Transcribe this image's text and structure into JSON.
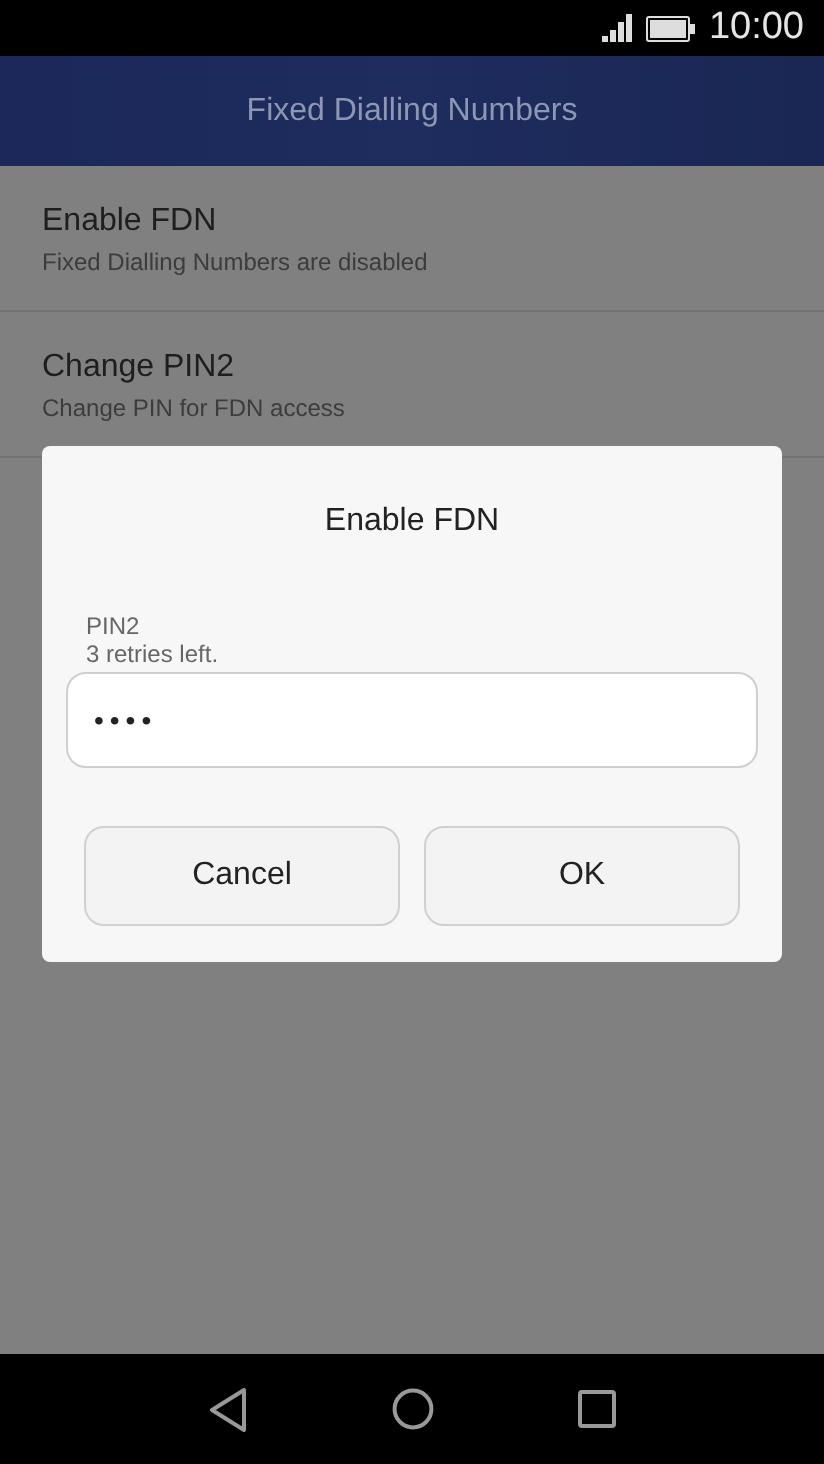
{
  "status_bar": {
    "time": "10:00"
  },
  "header": {
    "title": "Fixed Dialling Numbers"
  },
  "settings": [
    {
      "title": "Enable FDN",
      "subtitle": "Fixed Dialling Numbers are disabled"
    },
    {
      "title": "Change PIN2",
      "subtitle": "Change PIN for FDN access"
    }
  ],
  "dialog": {
    "title": "Enable FDN",
    "label": "PIN2",
    "hint": "3 retries left.",
    "value": "••••",
    "buttons": [
      "Cancel",
      "OK"
    ]
  }
}
